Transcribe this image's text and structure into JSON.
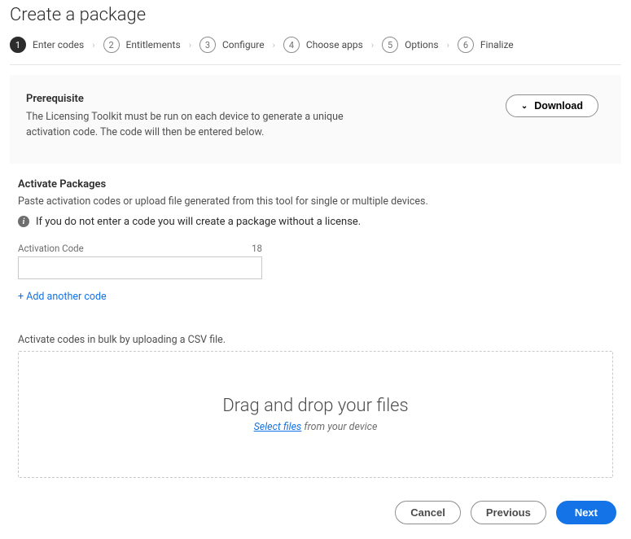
{
  "title": "Create a package",
  "wizard": [
    {
      "num": "1",
      "label": "Enter codes"
    },
    {
      "num": "2",
      "label": "Entitlements"
    },
    {
      "num": "3",
      "label": "Configure"
    },
    {
      "num": "4",
      "label": "Choose apps"
    },
    {
      "num": "5",
      "label": "Options"
    },
    {
      "num": "6",
      "label": "Finalize"
    }
  ],
  "prereq": {
    "heading": "Prerequisite",
    "text": "The Licensing Toolkit must be run on each device to generate a unique activation code. The code will then be entered below.",
    "download": "Download"
  },
  "activate": {
    "heading": "Activate Packages",
    "sub": "Paste activation codes or upload file generated from this tool for single or multiple devices.",
    "info": "If you do not enter a code you will create a package without a license.",
    "field_label": "Activation Code",
    "char_count": "18",
    "value": "",
    "add_link": "+ Add another code"
  },
  "bulk": {
    "label": "Activate codes in bulk by uploading a CSV file.",
    "dz_title": "Drag and drop your files",
    "dz_link": "Select files",
    "dz_suffix": " from your device"
  },
  "footer": {
    "cancel": "Cancel",
    "previous": "Previous",
    "next": "Next"
  }
}
